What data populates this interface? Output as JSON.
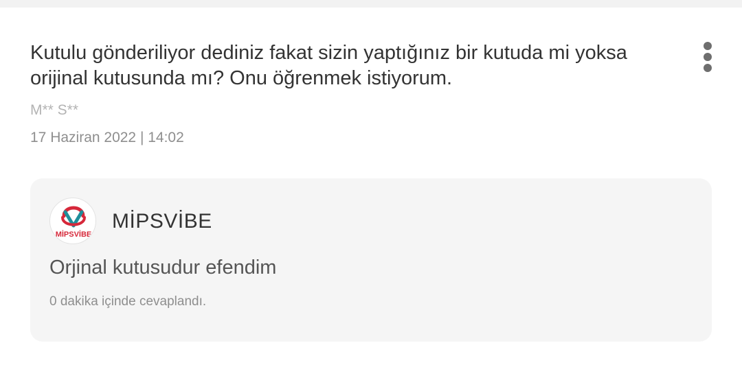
{
  "question": {
    "text": "Kutulu gönderiliyor dediniz fakat sizin yaptığınız bir kutuda mi yoksa orijinal kutusunda mı? Onu öğrenmek istiyorum.",
    "author": "M** S**",
    "date": "17 Haziran 2022 | 14:02",
    "menu_icon": "more-vertical-icon"
  },
  "answer": {
    "seller_name": "MİPSVİBE",
    "logo_text": "MİPSVİBE",
    "text": "Orjinal kutusudur efendim",
    "meta": "0 dakika içinde cevaplandı."
  },
  "colors": {
    "primary_text": "#333333",
    "muted_text": "#8e8e8e",
    "answer_background": "#f5f5f5",
    "logo_red": "#d6283a",
    "logo_teal": "#1f8f9b"
  }
}
